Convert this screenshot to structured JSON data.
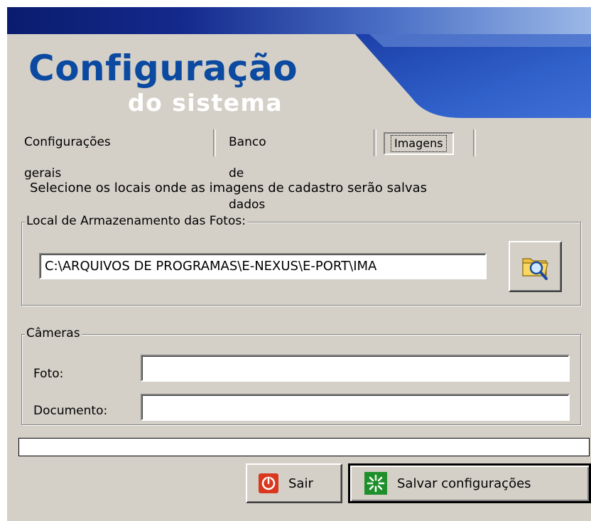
{
  "banner": {
    "title": "Configuração",
    "subtitle": "do sistema"
  },
  "tabs": [
    {
      "label": "Configurações gerais",
      "active": false
    },
    {
      "label": "Banco de dados",
      "active": false
    },
    {
      "label": "Imagens",
      "active": true
    }
  ],
  "instruction": "Selecione os locais onde as imagens de cadastro serão salvas",
  "storage": {
    "legend": "Local de Armazenamento das Fotos:",
    "path_value": "C:\\ARQUIVOS DE PROGRAMAS\\E-NEXUS\\E-PORT\\IMA",
    "browse_icon": "folder-search-icon"
  },
  "cameras": {
    "legend": "Câmeras",
    "photo_label": "Foto:",
    "photo_value": "",
    "document_label": "Documento:",
    "document_value": ""
  },
  "progress": {
    "value": 0
  },
  "buttons": {
    "exit_label": "Sair",
    "exit_icon": "power-icon",
    "save_label": "Salvar configurações",
    "save_icon": "sparkle-icon"
  },
  "colors": {
    "title": "#0b4aa0",
    "window_bg": "#d4d0c8",
    "titlebar_start": "#0a1c6e",
    "exit_icon_bg": "#d9381e",
    "save_icon_bg": "#1f8f2c"
  }
}
